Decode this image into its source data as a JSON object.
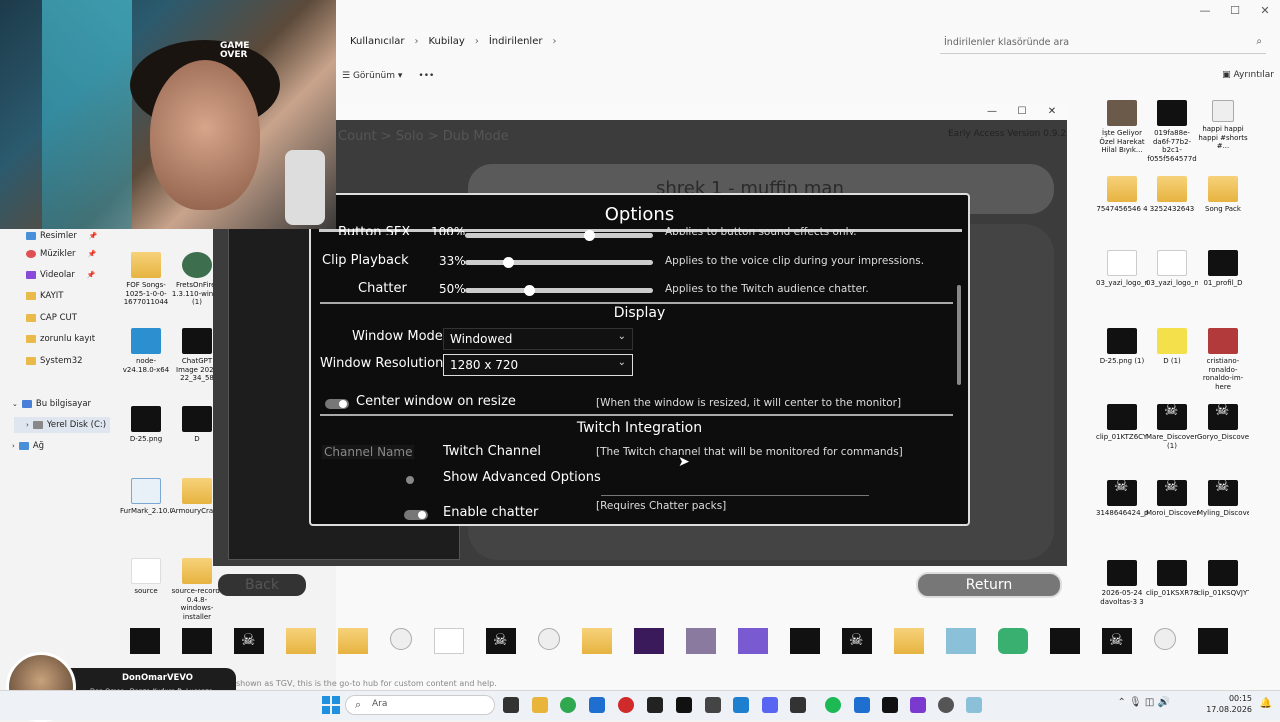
{
  "explorer": {
    "window_controls": [
      "—",
      "☐",
      "✕"
    ],
    "breadcrumbs": [
      "Kullanıcılar",
      "Kubilay",
      "İndirilenler"
    ],
    "search_placeholder": "İndirilenler klasöründe ara",
    "toolbar": {
      "view_label": "Görünüm",
      "more_label": "•••"
    },
    "details_label": "Ayrıntılar",
    "nav": [
      {
        "label": "Resimler",
        "pinned": true
      },
      {
        "label": "Müzikler",
        "pinned": true
      },
      {
        "label": "Videolar",
        "pinned": true
      },
      {
        "label": "KAYIT"
      },
      {
        "label": "CAP CUT"
      },
      {
        "label": "zorunlu kayıt"
      },
      {
        "label": "System32"
      },
      {
        "label": "Bu bilgisayar"
      },
      {
        "label": "Yerel Disk (C:)"
      },
      {
        "label": "Ağ"
      }
    ]
  },
  "desktop_icons": [
    {
      "label": "FOF Songs-1025-1-0-0-1677011044"
    },
    {
      "label": "FretsOnFire-1.3.110-win32 (1)"
    },
    {
      "label": "node-v24.18.0-x64"
    },
    {
      "label": "ChatGPT Image 2026 22_34_58"
    },
    {
      "label": "D-25.png"
    },
    {
      "label": "D"
    },
    {
      "label": "FurMark_2.10.0_Win64_Setup"
    },
    {
      "label": "ArmouryCrateInstallTool"
    },
    {
      "label": "source"
    },
    {
      "label": "source-record-0.4.8-windows-installer"
    },
    {
      "label": "İşte Geliyor Özel Harekat Hilal Bıyık..."
    },
    {
      "label": "019fa88e-da6f-77b2-b2c1-f055f564577d"
    },
    {
      "label": "happi happi happi #shorts #..."
    },
    {
      "label": "7547456546 4"
    },
    {
      "label": "3252432643"
    },
    {
      "label": "Song Pack"
    },
    {
      "label": "03_yazi_logo_neon_1"
    },
    {
      "label": "03_yazi_logo_neon"
    },
    {
      "label": "01_profil_D"
    },
    {
      "label": "D-25.png (1)"
    },
    {
      "label": "D (1)"
    },
    {
      "label": "cristiano-ronaldo-ronaldo-im-here"
    },
    {
      "label": "clip_01KTZ6CYP3P3X0DZ3JC1QPGTQB"
    },
    {
      "label": "Mare_Discovered (1)"
    },
    {
      "label": "Goryo_Discovered"
    },
    {
      "label": "3148646424_preview_obambo"
    },
    {
      "label": "Moroi_Discovered"
    },
    {
      "label": "Myling_Discovered"
    },
    {
      "label": "2026-05-24 davoltas-3 3"
    },
    {
      "label": "clip_01KSXR78BB8Y8THFEATQPA4CDH"
    },
    {
      "label": "clip_01KSQVJYTSHNS7YRYK5SRFSJTB"
    }
  ],
  "game": {
    "window_controls": [
      "—",
      "☐",
      "✕"
    ],
    "breadcrumb": "Count > Solo > Dub Mode",
    "version": "Early Access Version 0.9.2",
    "track_title": "shrek 1 - muffin man",
    "back_label": "Back",
    "return_label": "Return"
  },
  "options": {
    "title": "Options",
    "audio_rows": [
      {
        "label": "Button SFX",
        "pct": "100%",
        "value": 0.66,
        "desc": "Applies to button sound effects only."
      },
      {
        "label": "Clip Playback",
        "pct": "33%",
        "value": 0.23,
        "desc": "Applies to the voice clip during your impressions."
      },
      {
        "label": "Chatter",
        "pct": "50%",
        "value": 0.34,
        "desc": "Applies to the Twitch audience chatter."
      }
    ],
    "display_header": "Display",
    "window_mode_label": "Window Mode",
    "window_mode_value": "Windowed",
    "window_res_label": "Window Resolution",
    "window_res_value": "1280 x 720",
    "center_label": "Center window on resize",
    "center_desc": "[When the window is resized, it will center to the monitor]",
    "center_enabled": true,
    "twitch_header": "Twitch Integration",
    "channel_placeholder": "Channel Name",
    "channel_label": "Twitch Channel",
    "channel_desc": "[The Twitch channel that will be monitored for commands]",
    "advanced_label": "Show Advanced Options",
    "advanced_enabled": false,
    "chatter_label": "Enable chatter",
    "chatter_desc": "[Requires Chatter packs]",
    "chatter_enabled": true
  },
  "taskbar": {
    "search_label": "Ara",
    "time": "00:15",
    "date": "17.08.2026"
  },
  "now_playing": {
    "artist": "DonOmarVEVO",
    "title": "Don Omar - Danza Kuduro ft. Lucenzo"
  },
  "background_text": "shown as TGV, this is the go-to hub for custom content and help."
}
